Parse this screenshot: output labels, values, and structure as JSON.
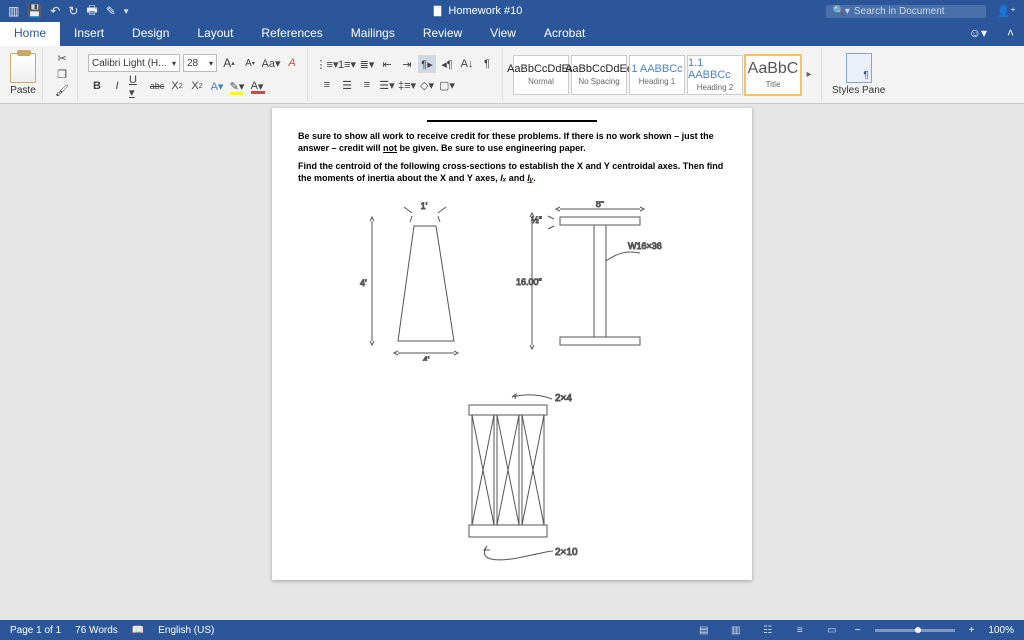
{
  "titlebar": {
    "doc_title": "Homework #10",
    "search_placeholder": "Search in Document"
  },
  "tabs": [
    "Home",
    "Insert",
    "Design",
    "Layout",
    "References",
    "Mailings",
    "Review",
    "View",
    "Acrobat"
  ],
  "active_tab": 0,
  "ribbon": {
    "paste": "Paste",
    "font_name": "Calibri Light (H...",
    "font_size": "28",
    "styles": [
      {
        "preview": "AaBbCcDdEe",
        "name": "Normal"
      },
      {
        "preview": "AaBbCcDdEe",
        "name": "No Spacing"
      },
      {
        "preview": "1 AABBCc",
        "name": "Heading 1"
      },
      {
        "preview": "1.1 AABBCc",
        "name": "Heading 2"
      },
      {
        "preview": "AaBbC",
        "name": "Title"
      }
    ],
    "pane": "Styles Pane"
  },
  "doc": {
    "p1a": "Be sure to show all work to receive credit for these problems. If there is no work shown – just the answer – credit will ",
    "p1not": "not",
    "p1b": " be given. Be sure to use engineering paper.",
    "p2a": "Find the centroid of the following cross-sections to establish the X and Y centroidal axes. Then find the moments of inertia about the X and Y axes, ",
    "p2ix": "Iₓ",
    "p2and": " and ",
    "p2iy": "Iᵧ",
    "p2end": ".",
    "dim1_h": "4'",
    "dim1_w": "4'",
    "dim1_t": "1'",
    "dim2_t": "½\"",
    "dim2_w": "8\"",
    "dim2_h": "16.00\"",
    "dim2_note": "W16×36",
    "dim3_top": "2×4",
    "dim3_bot": "2×10"
  },
  "status": {
    "page": "Page 1 of 1",
    "words": "76 Words",
    "lang": "English (US)",
    "zoom": "100%"
  }
}
